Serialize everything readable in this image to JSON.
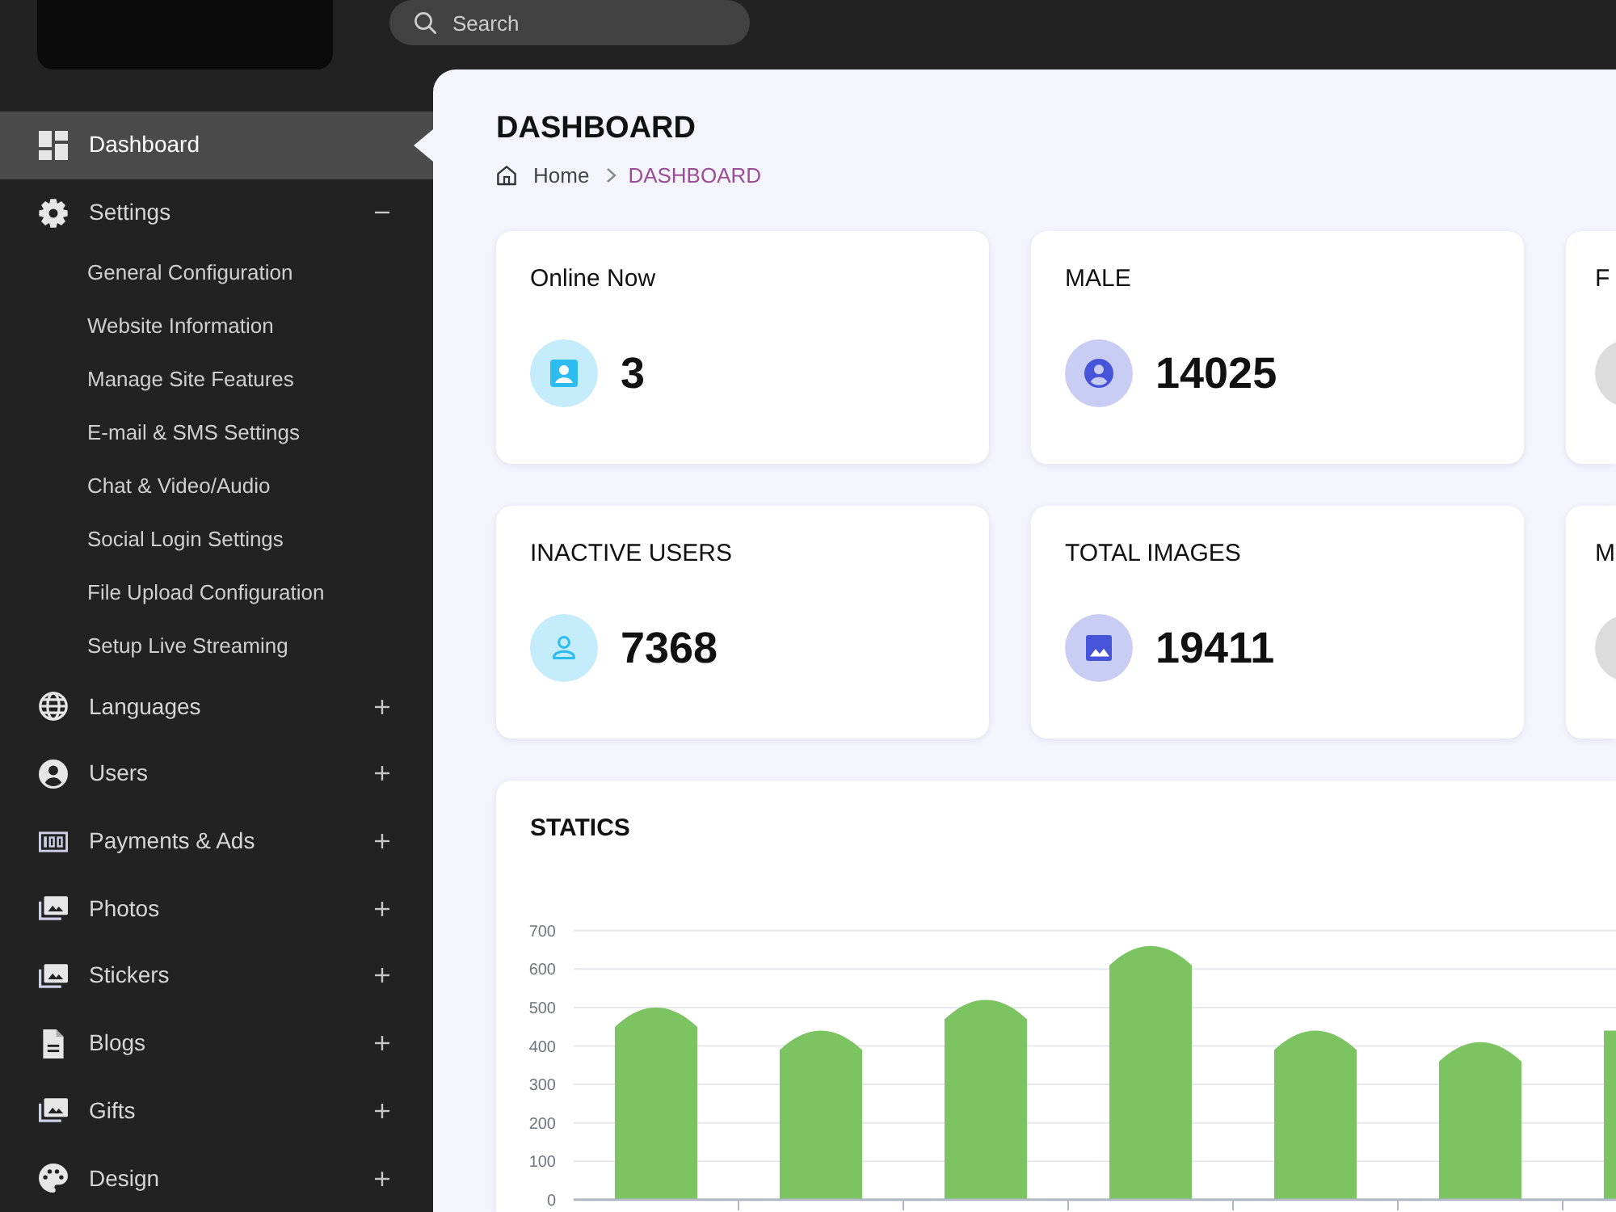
{
  "topbar": {
    "search": {
      "placeholder": "Search"
    }
  },
  "sidebar": {
    "items": [
      {
        "label": "Dashboard",
        "kind": "dashboard",
        "selected": true
      },
      {
        "label": "Settings",
        "kind": "gear",
        "selected": false,
        "expanded": true,
        "children": [
          {
            "label": "General Configuration",
            "selected": false
          },
          {
            "label": "Website Information",
            "selected": false
          },
          {
            "label": "Manage Site Features",
            "selected": false
          },
          {
            "label": "E-mail & SMS Settings",
            "selected": false
          },
          {
            "label": "Chat & Video/Audio",
            "selected": false
          },
          {
            "label": "Social Login Settings",
            "selected": false
          },
          {
            "label": "File Upload Configuration",
            "selected": false
          },
          {
            "label": "Setup Live Streaming",
            "selected": false
          }
        ]
      },
      {
        "label": "Languages",
        "kind": "globe",
        "selected": false,
        "expanded": false
      },
      {
        "label": "Users",
        "kind": "account",
        "selected": false,
        "expanded": false
      },
      {
        "label": "Payments & Ads",
        "kind": "banknote",
        "selected": false,
        "expanded": false
      },
      {
        "label": "Photos",
        "kind": "photos",
        "selected": false,
        "expanded": false
      },
      {
        "label": "Stickers",
        "kind": "photos",
        "selected": false,
        "expanded": false
      },
      {
        "label": "Blogs",
        "kind": "document",
        "selected": false,
        "expanded": false
      },
      {
        "label": "Gifts",
        "kind": "photos",
        "selected": false,
        "expanded": false
      },
      {
        "label": "Design",
        "kind": "palette",
        "selected": false,
        "expanded": false
      }
    ]
  },
  "page": {
    "title": "DASHBOARD",
    "breadcrumb": [
      {
        "label": "Home",
        "kind": "home",
        "current": false
      },
      {
        "label": "DASHBOARD",
        "kind": "plain",
        "current": true
      }
    ]
  },
  "stats": [
    {
      "title": "Online Now",
      "value": "3",
      "kind": "contact",
      "color": "#c4ecfb"
    },
    {
      "title": "MALE",
      "value": "14025",
      "kind": "account",
      "color": "#c9cdf4"
    },
    {
      "title": "F",
      "kind": "partial",
      "color": "#dcdcdc"
    },
    {
      "title": "INACTIVE USERS",
      "value": "7368",
      "kind": "person",
      "color": "#c4ecfb"
    },
    {
      "title": "TOTAL IMAGES",
      "value": "19411",
      "kind": "image",
      "color": "#c9cdf4"
    },
    {
      "title": "M",
      "kind": "partial",
      "color": "#dcdcdc"
    }
  ],
  "chart": {
    "chart_data": {
      "type": "bar",
      "title": "STATICS",
      "series": [
        {
          "color": "#7cc462",
          "values": [
            500,
            440,
            520,
            660,
            440,
            410,
            440
          ]
        }
      ],
      "ylim": [
        0,
        700
      ],
      "yticks": [
        0,
        100,
        200,
        300,
        400,
        500,
        600,
        700
      ],
      "grid": true
    }
  }
}
